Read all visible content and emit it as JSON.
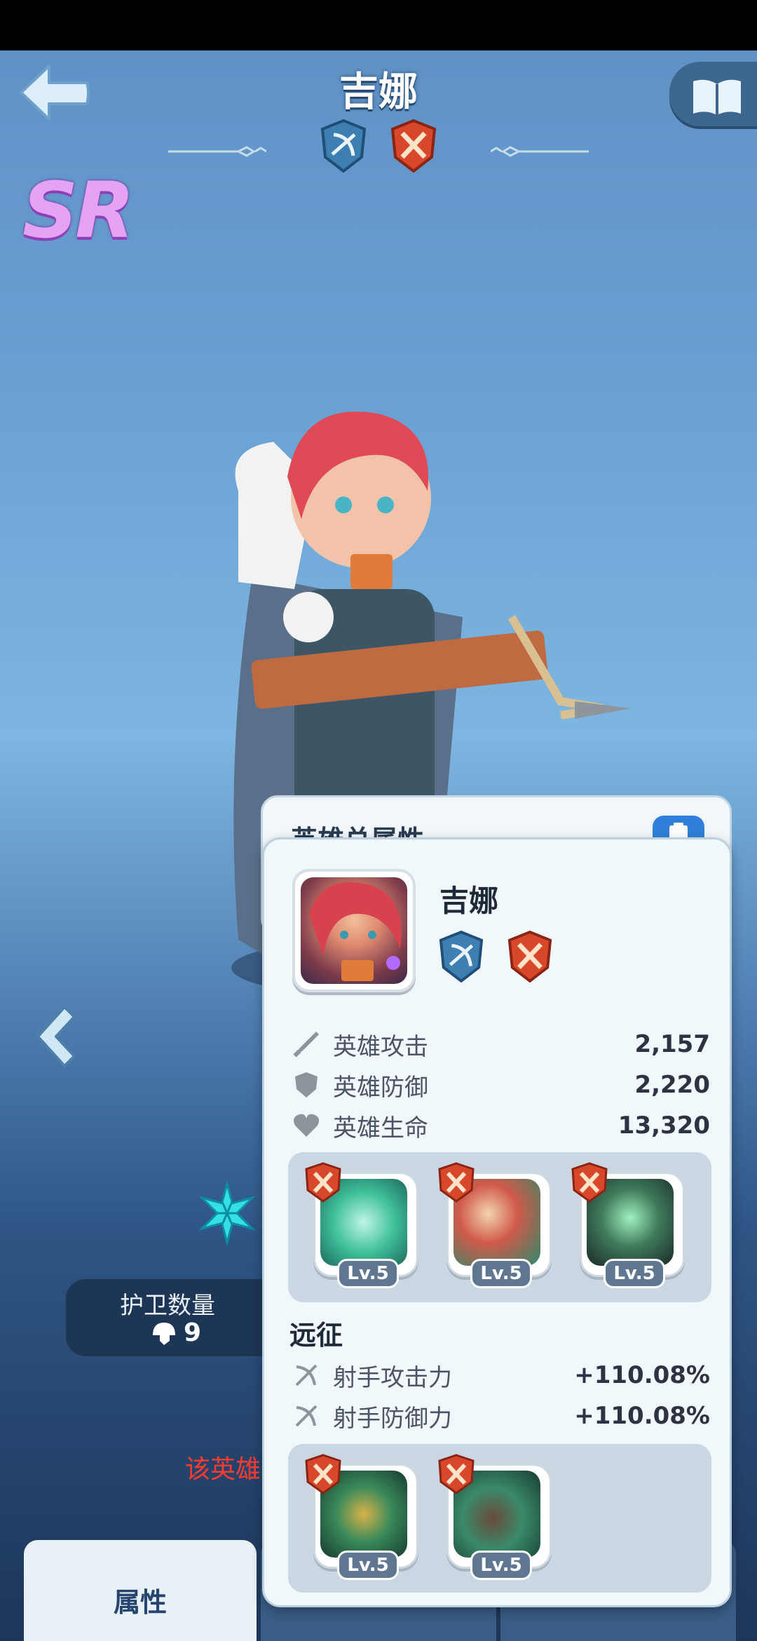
{
  "header": {
    "title": "吉娜",
    "rarity": "SR",
    "badges": [
      "crossbow-badge-icon",
      "crossed-swords-badge-icon"
    ]
  },
  "guard": {
    "label": "护卫数量",
    "value": "9"
  },
  "red_note": "该英雄",
  "tabs": [
    {
      "label": "属性",
      "active": true
    },
    {
      "label": "",
      "active": false
    },
    {
      "label": "",
      "active": false
    }
  ],
  "panel_behind": {
    "title": "英雄总属性"
  },
  "panel": {
    "hero_name": "吉娜",
    "stats": [
      {
        "icon": "sword-icon",
        "label": "英雄攻击",
        "value": "2,157"
      },
      {
        "icon": "shield-icon",
        "label": "英雄防御",
        "value": "2,220"
      },
      {
        "icon": "heart-icon",
        "label": "英雄生命",
        "value": "13,320"
      }
    ],
    "skills": [
      {
        "level": "Lv.5"
      },
      {
        "level": "Lv.5"
      },
      {
        "level": "Lv.5"
      }
    ],
    "expedition": {
      "title": "远征",
      "stats": [
        {
          "icon": "crossbow-icon",
          "label": "射手攻击力",
          "value": "+110.08%"
        },
        {
          "icon": "crossbow-icon",
          "label": "射手防御力",
          "value": "+110.08%"
        }
      ],
      "skills": [
        {
          "level": "Lv.5"
        },
        {
          "level": "Lv.5"
        }
      ]
    }
  },
  "colors": {
    "accent": "#2f80d8",
    "skill_mark": "#d9472b",
    "badge_blue": "#3d7fb0",
    "red_text": "#ff3b30"
  }
}
